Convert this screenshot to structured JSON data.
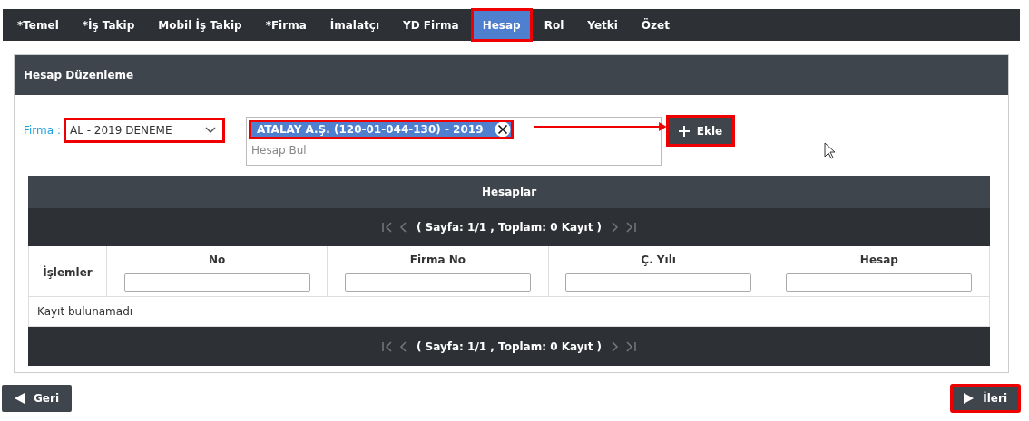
{
  "tabs": [
    {
      "label": "*Temel",
      "selected": false,
      "highlighted": false
    },
    {
      "label": "*İş Takip",
      "selected": false,
      "highlighted": false
    },
    {
      "label": "Mobil İş Takip",
      "selected": false,
      "highlighted": false
    },
    {
      "label": "*Firma",
      "selected": false,
      "highlighted": false
    },
    {
      "label": "İmalatçı",
      "selected": false,
      "highlighted": false
    },
    {
      "label": "YD Firma",
      "selected": false,
      "highlighted": false
    },
    {
      "label": "Hesap",
      "selected": true,
      "highlighted": true
    },
    {
      "label": "Rol",
      "selected": false,
      "highlighted": false
    },
    {
      "label": "Yetki",
      "selected": false,
      "highlighted": false
    },
    {
      "label": "Özet",
      "selected": false,
      "highlighted": false
    }
  ],
  "panel": {
    "title": "Hesap Düzenleme",
    "firma": {
      "label": "Firma :",
      "value": "AL - 2019 DENEME",
      "highlighted": true
    },
    "account_picker": {
      "tags": [
        {
          "label": "ATALAY A.Ş. (120-01-044-130) - 2019",
          "highlighted": true
        }
      ],
      "placeholder": "Hesap Bul"
    },
    "add_button": {
      "label": "Ekle",
      "highlighted": true
    },
    "table": {
      "title": "Hesaplar",
      "pager": "( Sayfa: 1/1 , Toplam: 0 Kayıt )",
      "action_column": "İşlemler",
      "columns": [
        "No",
        "Firma No",
        "Ç. Yılı",
        "Hesap"
      ],
      "empty_message": "Kayıt bulunamadı",
      "footer_pager": "( Sayfa: 1/1 , Toplam: 0 Kayıt )"
    }
  },
  "buttons": [
    {
      "label": "Geri",
      "kind": "back",
      "highlighted": false
    },
    {
      "label": "İleri",
      "kind": "next",
      "highlighted": true
    }
  ]
}
